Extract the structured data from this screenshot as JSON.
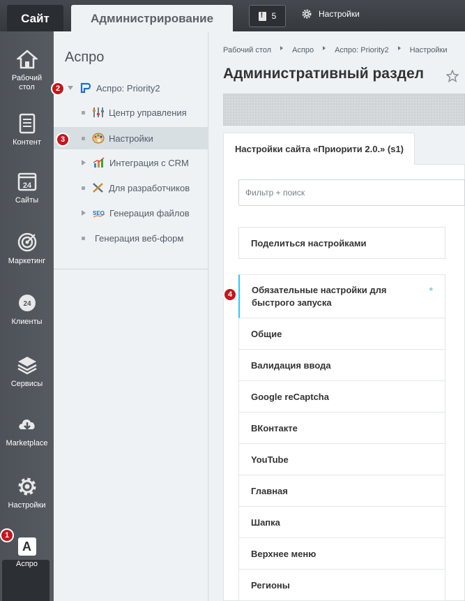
{
  "topbar": {
    "site_tab": "Сайт",
    "admin_tab": "Администрирование",
    "notifications_count": "5",
    "settings_label": "Настройки"
  },
  "rail": [
    {
      "label": "Рабочий стол",
      "icon": "home-icon"
    },
    {
      "label": "Контент",
      "icon": "document-icon"
    },
    {
      "label": "Сайты",
      "icon": "calendar-24-icon"
    },
    {
      "label": "Маркетинг",
      "icon": "target-icon"
    },
    {
      "label": "Клиенты",
      "icon": "clients-24-icon"
    },
    {
      "label": "Сервисы",
      "icon": "layers-icon"
    },
    {
      "label": "Marketplace",
      "icon": "cloud-download-icon"
    },
    {
      "label": "Настройки",
      "icon": "gear-icon"
    },
    {
      "label": "Аспро",
      "icon": "aspro-a-icon",
      "glyph": "A"
    }
  ],
  "menu": {
    "title": "Аспро",
    "items": [
      {
        "label": "Аспро: Priority2"
      },
      {
        "label": "Центр управления"
      },
      {
        "label": "Настройки"
      },
      {
        "label": "Интеграция с CRM"
      },
      {
        "label": "Для разработчиков"
      },
      {
        "label": "Генерация файлов"
      },
      {
        "label": "Генерация веб-форм"
      }
    ]
  },
  "badges": [
    "1",
    "2",
    "3",
    "4"
  ],
  "breadcrumb": [
    "Рабочий стол",
    "Аспро",
    "Аспро: Priority2",
    "Настройки"
  ],
  "page_title": "Административный раздел",
  "tab_label": "Настройки сайта «Приорити 2.0.» (s1)",
  "filter_placeholder": "Фильтр + поиск",
  "share_label": "Поделиться настройками",
  "required_mark": "*",
  "settings_list": [
    "Обязательные настройки для быстрого запуска",
    "Общие",
    "Валидация ввода",
    "Google reCaptcha",
    "ВКонтакте",
    "YouTube",
    "Главная",
    "Шапка",
    "Верхнее меню",
    "Регионы"
  ]
}
